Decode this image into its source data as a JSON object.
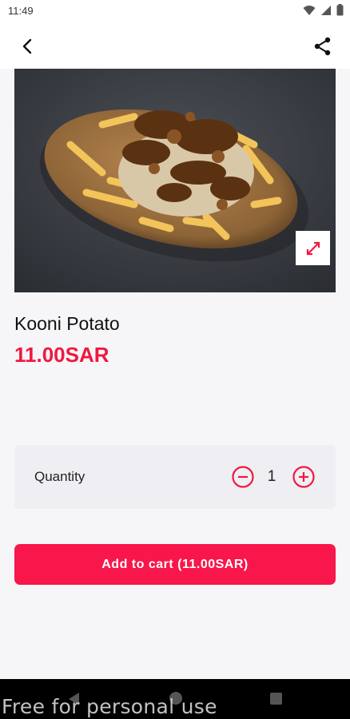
{
  "status_bar": {
    "time": "11:49"
  },
  "product": {
    "name": "Kooni Potato",
    "price": "11.00SAR"
  },
  "quantity": {
    "label": "Quantity",
    "value": "1"
  },
  "cart_button": {
    "label": "Add to cart (11.00SAR)"
  },
  "watermark": "Free for personal use",
  "icons": {
    "back": "back-arrow-icon",
    "share": "share-icon",
    "expand": "expand-icon",
    "minus": "minus-circle-icon",
    "plus": "plus-circle-icon"
  },
  "colors": {
    "accent": "#f8164a",
    "price": "#f0183f"
  }
}
